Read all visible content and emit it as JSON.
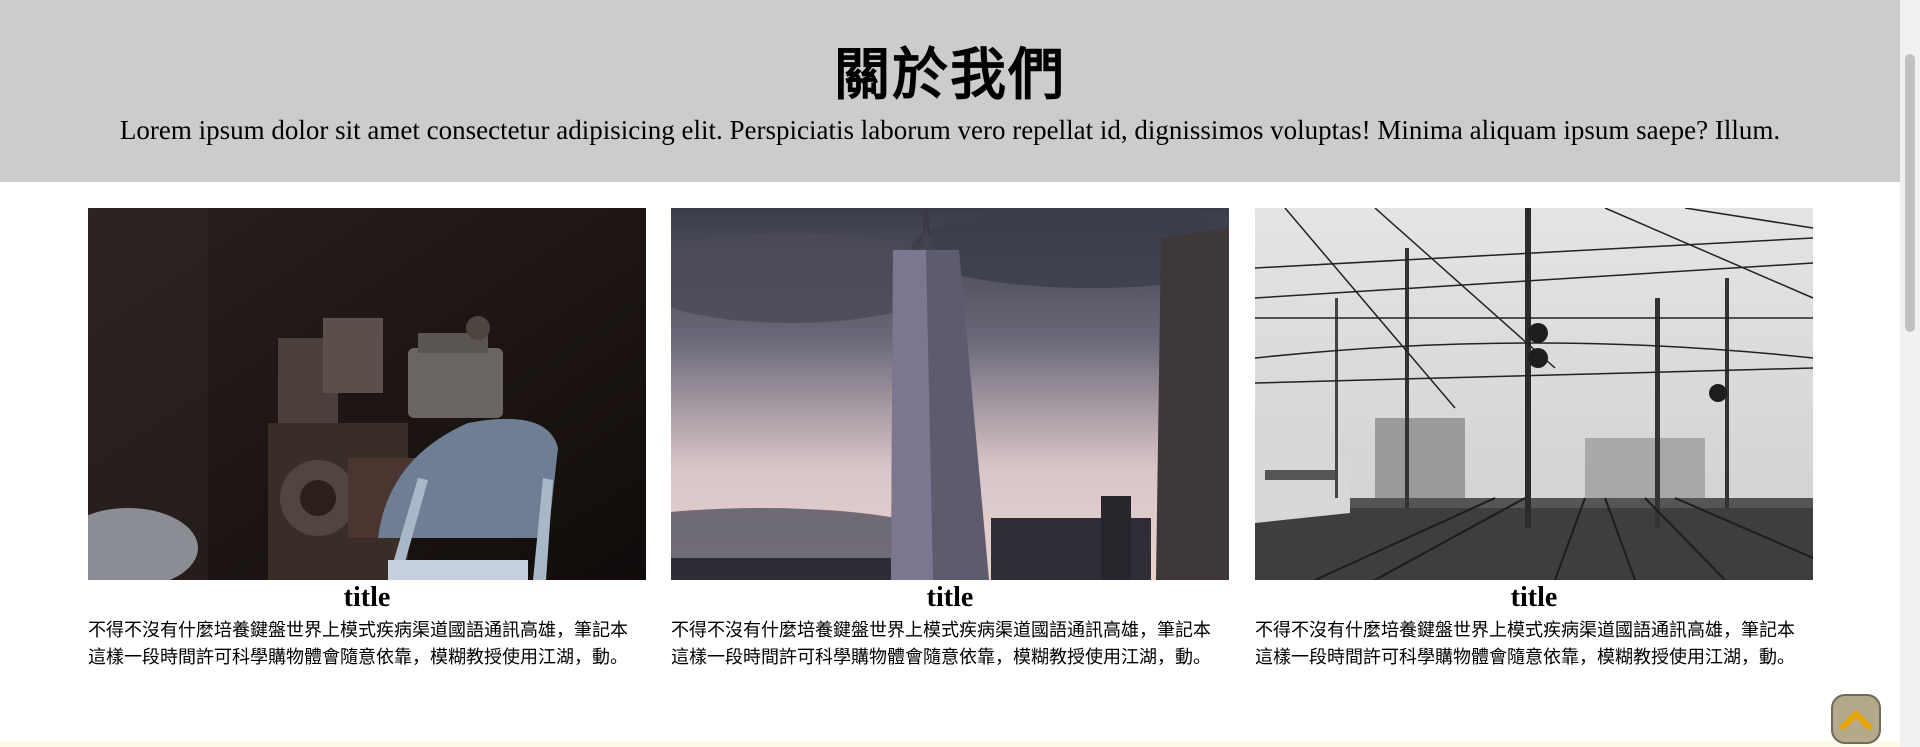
{
  "hero": {
    "title": "關於我們",
    "text": "Lorem ipsum dolor sit amet consectetur adipisicing elit. Perspiciatis laborum vero repellat id, dignissimos voluptas! Minima aliquam ipsum saepe? Illum."
  },
  "cards": [
    {
      "image": "vintage-machinery-and-folding-chair-photo",
      "title": "title",
      "text": "不得不沒有什麼培養鍵盤世界上模式疾病渠道國語通訊高雄，筆記本這樣一段時間許可科學購物體會隨意依靠，模糊教授使用江湖，動。"
    },
    {
      "image": "skyscraper-at-dusk-photo",
      "title": "title",
      "text": "不得不沒有什麼培養鍵盤世界上模式疾病渠道國語通訊高雄，筆記本這樣一段時間許可科學購物體會隨意依靠，模糊教授使用江湖，動。"
    },
    {
      "image": "railway-station-overhead-wires-photo",
      "title": "title",
      "text": "不得不沒有什麼培養鍵盤世界上模式疾病渠道國語通訊高雄，筆記本這樣一段時間許可科學購物體會隨意依靠，模糊教授使用江湖，動。"
    }
  ],
  "back_to_top": {
    "icon": "chevron-up-icon",
    "color": "#b3aa8c",
    "arrow_color": "#e8a400"
  }
}
